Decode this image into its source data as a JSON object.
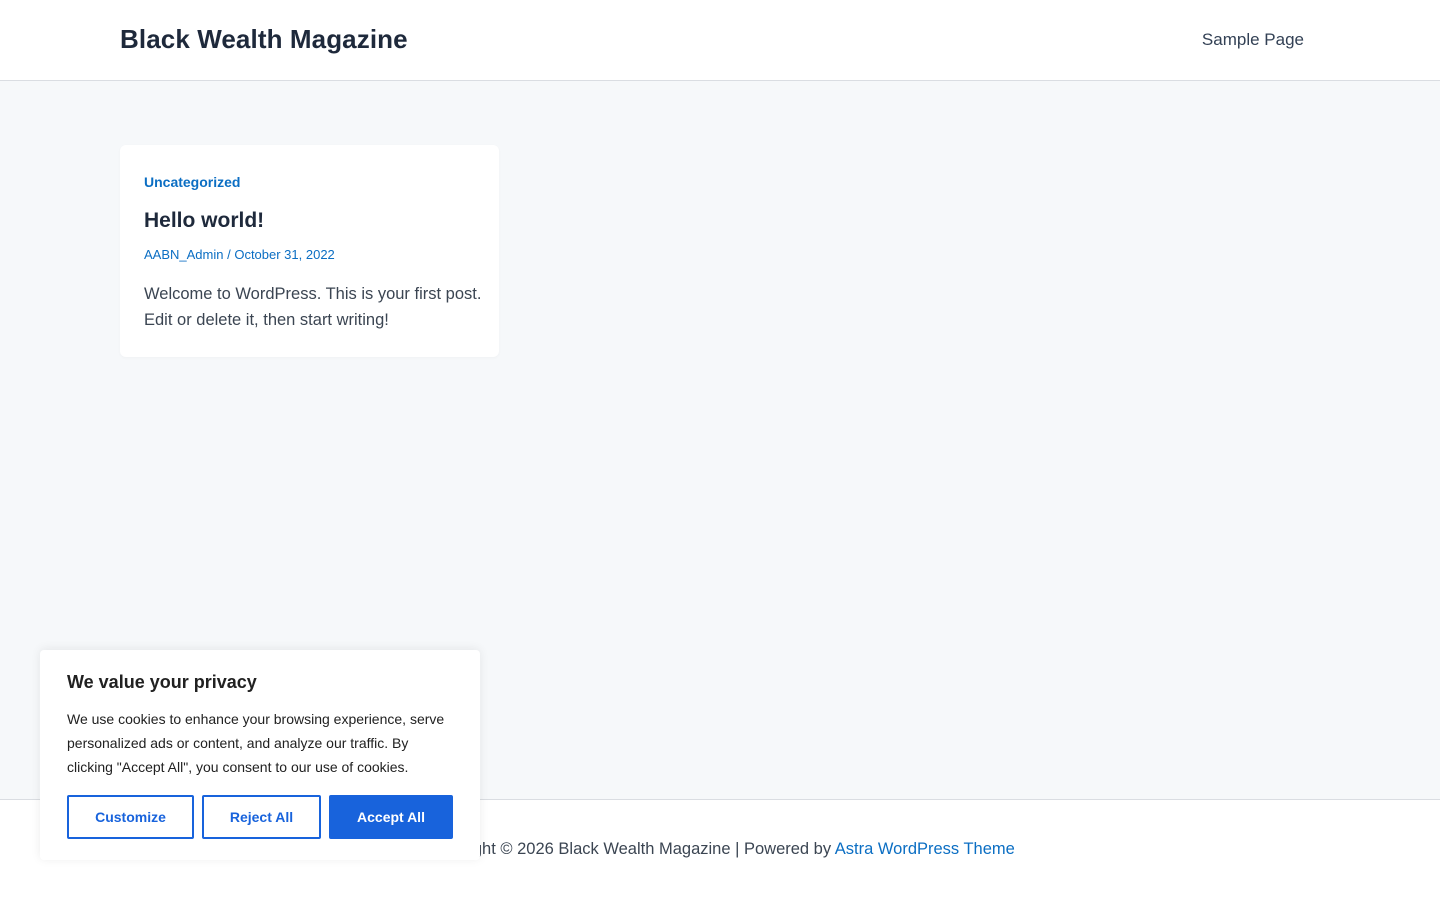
{
  "header": {
    "site_title": "Black Wealth Magazine",
    "nav": {
      "sample_page": "Sample Page"
    }
  },
  "post": {
    "category": "Uncategorized",
    "title": "Hello world!",
    "author": "AABN_Admin",
    "separator": " / ",
    "date": "October 31, 2022",
    "excerpt": "Welcome to WordPress. This is your first post. Edit or delete it, then start writing!"
  },
  "footer": {
    "copyright": "Copyright © 2026 Black Wealth Magazine | Powered by ",
    "theme_link": "Astra WordPress Theme"
  },
  "cookie_banner": {
    "title": "We value your privacy",
    "text": "We use cookies to enhance your browsing experience, serve personalized ads or content, and analyze our traffic. By clicking \"Accept All\", you consent to our use of cookies.",
    "customize_label": "Customize",
    "reject_label": "Reject All",
    "accept_label": "Accept All"
  },
  "colors": {
    "background": "#f6f8fa",
    "link": "#0b6ec3",
    "heading": "#1e293b",
    "cookie_accent": "#1863dc"
  }
}
